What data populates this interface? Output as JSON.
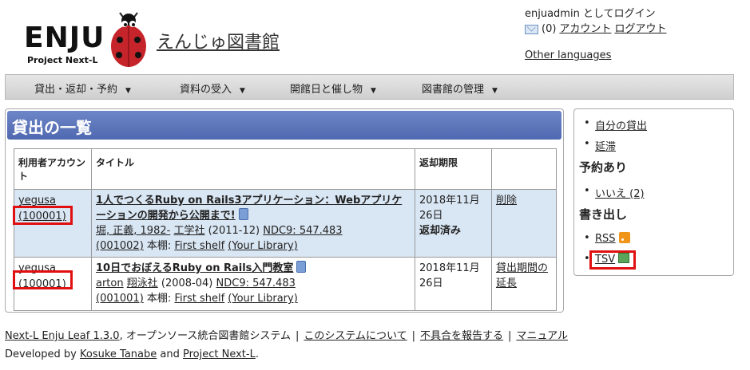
{
  "header": {
    "logo_text": "ENJU",
    "logo_sub": "Project Next-L",
    "site_title": "えんじゅ図書館",
    "login_status": "enjuadmin としてログイン",
    "message_count": "(0)",
    "account_link": "アカウント",
    "logout_link": "ログアウト",
    "other_languages": "Other languages"
  },
  "nav": {
    "items": [
      {
        "label": "貸出・返却・予約"
      },
      {
        "label": "資料の受入"
      },
      {
        "label": "開館日と催し物"
      },
      {
        "label": "図書館の管理"
      }
    ],
    "caret": "▼"
  },
  "main": {
    "title": "貸出の一覧",
    "columns": [
      "利用者アカウント",
      "タイトル",
      "返却期限",
      ""
    ],
    "rows": [
      {
        "user": "yegusa",
        "user_number": "(100001)",
        "title": "1人でつくるRuby on Rails3アプリケーション：Webアプリケーションの開発から公開まで!",
        "author": "堀, 正義, 1982-",
        "publisher": "工学社",
        "pub_year": "(2011-12)",
        "ndc": "NDC9: 547.483",
        "item_id": "(001002)",
        "shelf_label": "本棚:",
        "shelf": "First shelf",
        "library": "(Your Library)",
        "due": "2018年11月26日",
        "status": "返却済み",
        "action": "削除"
      },
      {
        "user": "yegusa",
        "user_number": "(100001)",
        "title": "10日でおぼえるRuby on Rails入門教室",
        "author": "arton",
        "publisher": "翔泳社",
        "pub_year": "(2008-04)",
        "ndc": "NDC9: 547.483",
        "item_id": "(001001)",
        "shelf_label": "本棚:",
        "shelf": "First shelf",
        "library": "(Your Library)",
        "due": "2018年11月26日",
        "status": "",
        "action": "貸出期間の延長"
      }
    ]
  },
  "sidebar": {
    "my_loans": "自分の貸出",
    "overdue": "延滞",
    "reserved_heading": "予約あり",
    "reserved_option": "いいえ (2)",
    "export_heading": "書き出し",
    "rss": "RSS",
    "tsv": "TSV"
  },
  "footer": {
    "version": "Next-L Enju Leaf 1.3.0",
    "description": ", オープンソース統合図書館システム",
    "about": "このシステムについて",
    "report": "不具合を報告する",
    "manual": "マニュアル",
    "developed_prefix": "Developed by",
    "developer": "Kosuke Tanabe",
    "and": "and",
    "org": "Project Next-L",
    "period": "."
  },
  "colors": {
    "title_bar": "#5a72b8",
    "row_highlight": "#d9e6f3",
    "highlight_box": "#e01010"
  }
}
